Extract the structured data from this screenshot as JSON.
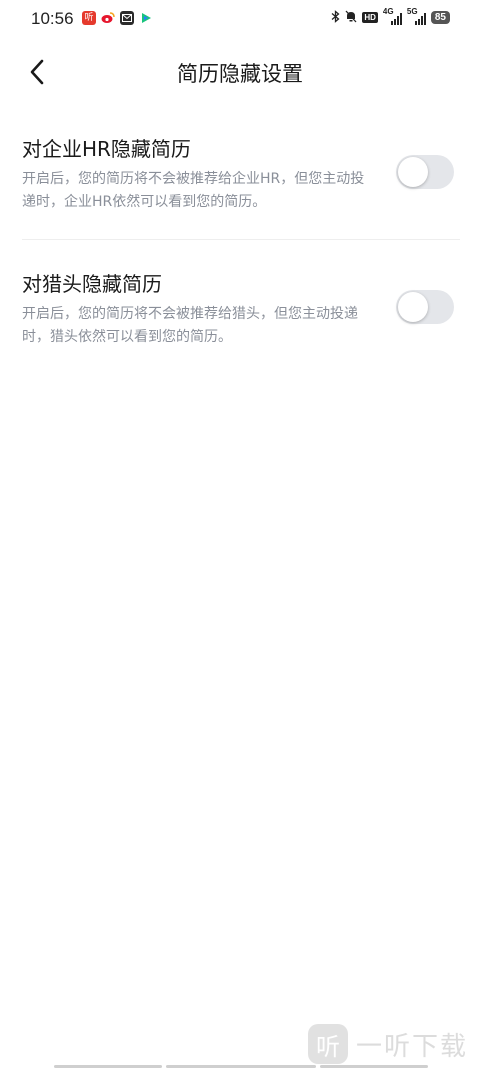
{
  "status_bar": {
    "time": "10:56",
    "hd_label": "HD",
    "network_1": "4G",
    "network_2": "5G",
    "battery": "85"
  },
  "header": {
    "title": "简历隐藏设置"
  },
  "settings": [
    {
      "title": "对企业HR隐藏简历",
      "description": "开启后，您的简历将不会被推荐给企业HR，但您主动投递时，企业HR依然可以看到您的简历。",
      "enabled": false
    },
    {
      "title": "对猎头隐藏简历",
      "description": "开启后，您的简历将不会被推荐给猎头，但您主动投递时，猎头依然可以看到您的简历。",
      "enabled": false
    }
  ],
  "watermark": {
    "logo_char": "听",
    "text": "一听下载"
  },
  "colors": {
    "toggle_off": "#e4e6ea",
    "description_text": "#8a8f99",
    "title_text": "#1a1a1a"
  },
  "icons": {
    "back": "chevron-left-icon"
  }
}
